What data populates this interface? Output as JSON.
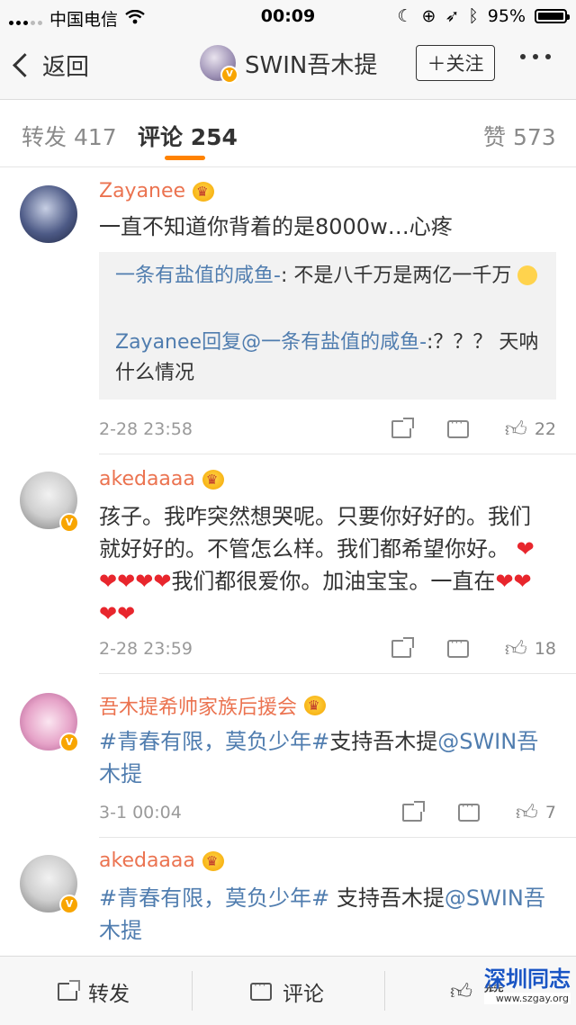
{
  "status_bar": {
    "carrier": "中国电信",
    "time": "00:09",
    "battery": "95%"
  },
  "nav": {
    "back_label": "返回",
    "title": "SWIN吾木提",
    "follow_label": "＋关注"
  },
  "tabs": {
    "repost": "转发 417",
    "comments": "评论 254",
    "likes": "赞 573"
  },
  "comments": [
    {
      "name": "Zayanee",
      "text": "一直不知道你背着的是8000w…心疼",
      "replies": [
        {
          "user": "一条有盐值的咸鱼-",
          "text": ": 不是八千万是两亿一千万"
        },
        {
          "user": "Zayanee回复@一条有盐值的咸鱼-",
          "text": ":？？？ 天呐什么情况"
        }
      ],
      "time": "2-28 23:58",
      "likes": "22"
    },
    {
      "name": "akedaaaa",
      "text_a": "孩子。我咋突然想哭呢。只要你好好的。我们就好好的。不管怎么样。我们都希望你好。",
      "text_b": "我们都很爱你。加油宝宝。一直在",
      "time": "2-28 23:59",
      "likes": "18"
    },
    {
      "name": "吾木提希帅家族后援会",
      "topic": "#青春有限，莫负少年#",
      "text": "支持吾木提",
      "mention": "@SWIN吾木提",
      "time": "3-1 00:04",
      "likes": "7"
    },
    {
      "name": "akedaaaa",
      "topic": "#青春有限，莫负少年#",
      "text": " 支持吾木提",
      "mention": "@SWIN吾木提"
    }
  ],
  "bottom_bar": {
    "repost": "转发",
    "comment": "评论",
    "like": "赞"
  },
  "watermark": {
    "name": "深圳同志",
    "url": "www.szgay.org"
  },
  "colors": {
    "accent": "#ff8200",
    "username": "#eb7350",
    "link": "#507daf",
    "heart": "#e8262d"
  }
}
